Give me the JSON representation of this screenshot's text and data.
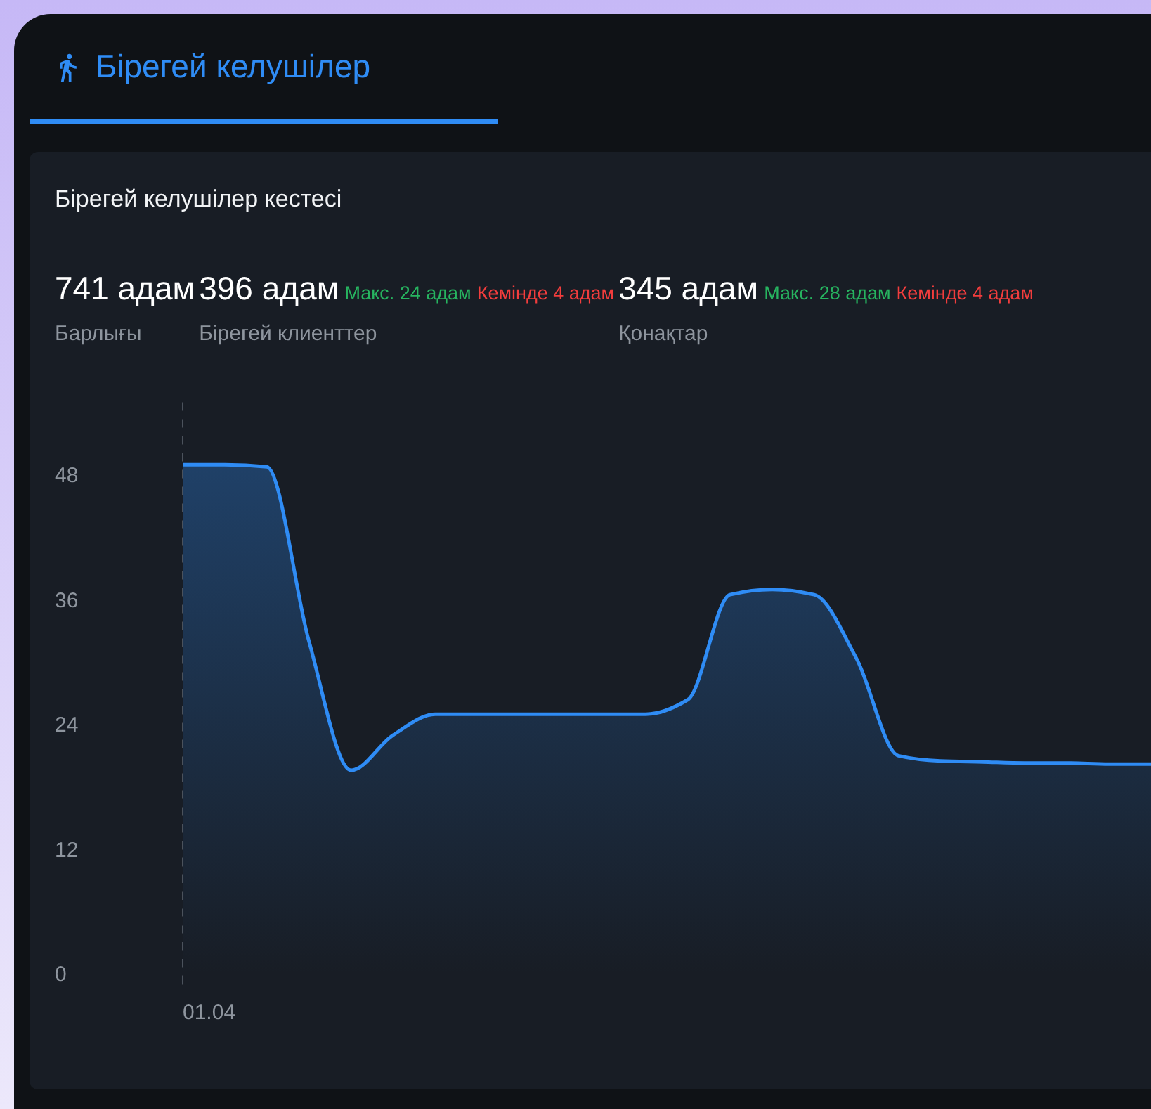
{
  "tabs": [
    {
      "label": "Бірегей келушілер",
      "selected": true
    }
  ],
  "card": {
    "title": "Бірегей келушілер кестесі",
    "stats": [
      {
        "value": "741 адам",
        "label": "Барлығы"
      },
      {
        "value": "396 адам",
        "label": "Бірегей клиенттер",
        "extras": [
          {
            "kind": "max",
            "text": "Макс. 24 адам"
          },
          {
            "kind": "min",
            "text": "Кемінде 4 адам"
          }
        ]
      },
      {
        "value": "345 адам",
        "label": "Қонақтар",
        "extras": [
          {
            "kind": "max",
            "text": "Макс. 28 адам"
          },
          {
            "kind": "min",
            "text": "Кемінде 4 адам"
          }
        ]
      }
    ],
    "chart_data": {
      "type": "area",
      "series": [
        {
          "color": "#2f8cf5",
          "values": [
            49,
            49,
            48.8,
            32,
            19.6,
            23,
            25,
            25,
            25,
            25,
            25,
            25,
            26.4,
            36.5,
            37,
            36.5,
            30.4,
            21,
            20.5,
            20.4,
            20.3,
            20.3,
            20.2,
            20.2
          ]
        }
      ],
      "ylim": [
        0,
        55
      ],
      "yticks": [
        0,
        12,
        24,
        36,
        48
      ]
    },
    "x_labels": [
      "01.04"
    ]
  }
}
